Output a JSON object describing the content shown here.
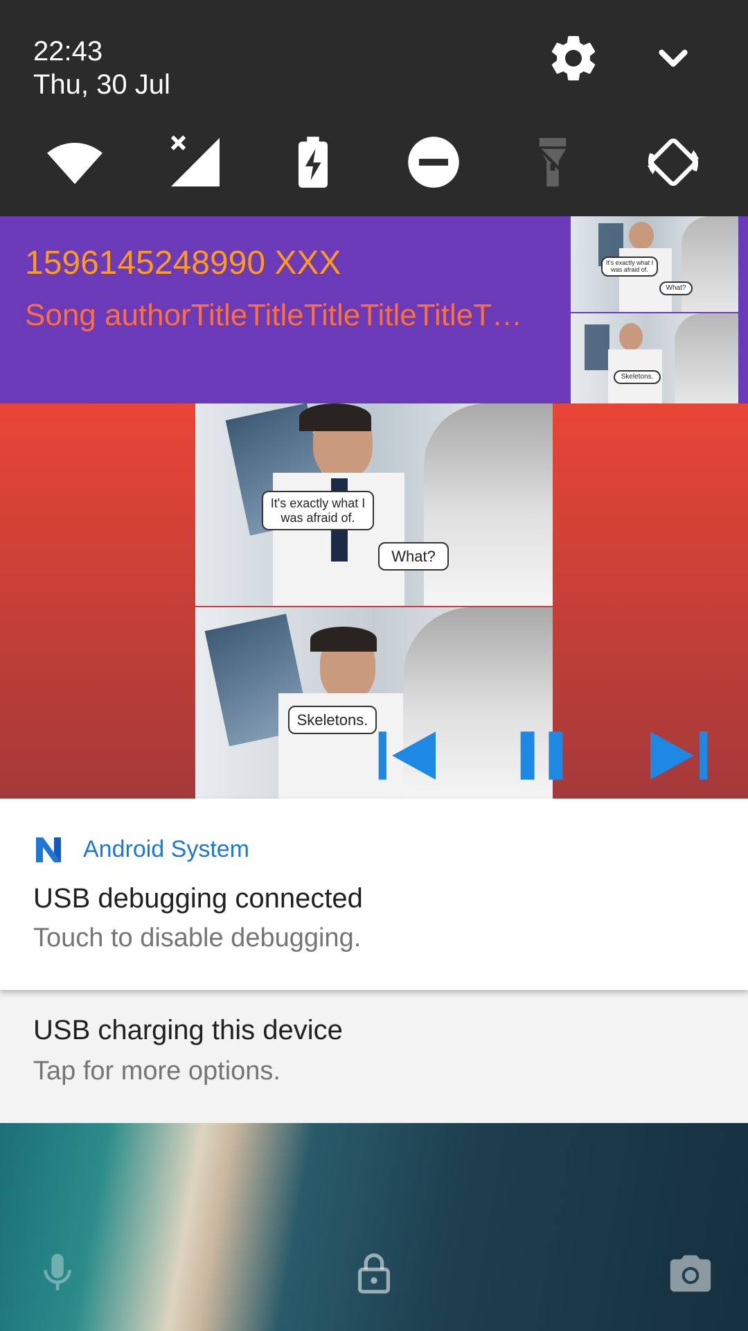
{
  "status": {
    "time": "22:43",
    "date": "Thu, 30 Jul"
  },
  "quick_settings": [
    "wifi-icon",
    "no-sim-icon",
    "battery-saver-icon",
    "do-not-disturb-icon",
    "flashlight-icon",
    "auto-rotate-icon"
  ],
  "media": {
    "title": "1596145248990 XXX",
    "subtitle": "Song authorTitleTitleTitleTitleTitleT…",
    "art_captions": {
      "panel1_left": "It's exactly what I was afraid of.",
      "panel1_right": "What?",
      "panel2": "Skeletons."
    },
    "colors": {
      "top_bg": "#6a3ab8",
      "bottom_bg": "#e84535",
      "title": "#ff9a1a",
      "subtitle": "#ff6f3c",
      "controls": "#1e88e5"
    }
  },
  "notifications": [
    {
      "app": "Android System",
      "title": "USB debugging connected",
      "text": "Touch to disable debugging."
    },
    {
      "title": "USB charging this device",
      "text": "Tap for more options."
    }
  ],
  "lockscreen": {
    "icons": [
      "mic-icon",
      "lock-icon",
      "camera-icon"
    ]
  }
}
